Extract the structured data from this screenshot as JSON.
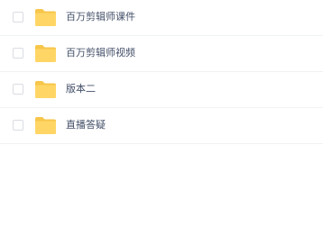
{
  "file_list": {
    "items": [
      {
        "name": "百万剪辑师课件",
        "icon": "folder-icon",
        "checked": false
      },
      {
        "name": "百万剪辑师视频",
        "icon": "folder-icon",
        "checked": false
      },
      {
        "name": "版本二",
        "icon": "folder-icon",
        "checked": false
      },
      {
        "name": "直播答疑",
        "icon": "folder-icon",
        "checked": false
      }
    ]
  },
  "colors": {
    "folder": "#ffd666",
    "folder_tab": "#f7c64a",
    "text": "#424e67",
    "row_border": "#f1f2f4",
    "checkbox_border": "#d9dce2"
  }
}
